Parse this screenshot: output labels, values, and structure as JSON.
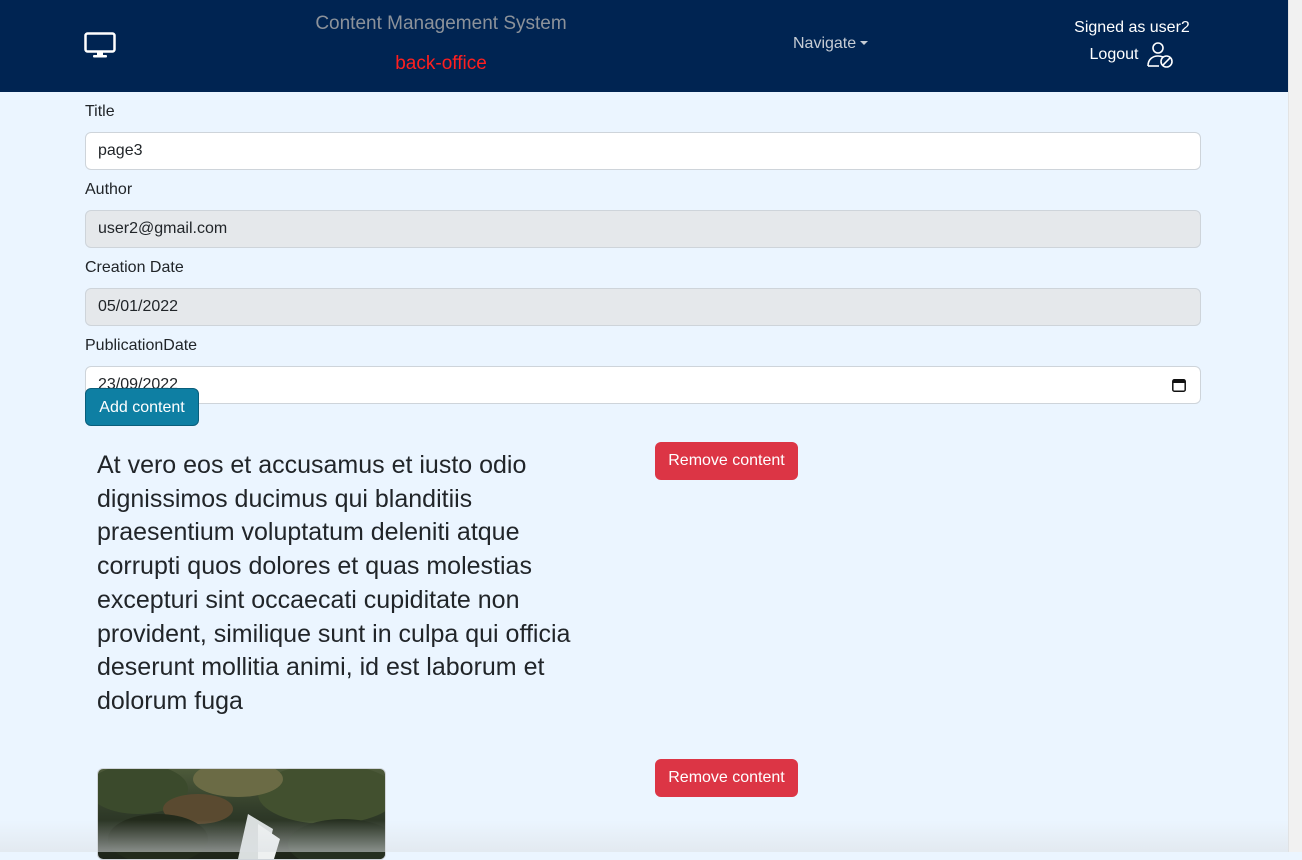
{
  "header": {
    "app_title": "Content Management System",
    "app_subtitle": "back-office",
    "brand_icon": "monitor-icon",
    "nav_label": "Navigate",
    "signed_in_text": "Signed as user2",
    "logout_label": "Logout",
    "logout_icon": "user-slash-icon"
  },
  "form": {
    "title_label": "Title",
    "title_value": "page3",
    "author_label": "Author",
    "author_value": "user2@gmail.com",
    "creation_label": "Creation Date",
    "creation_value": "05/01/2022",
    "publication_label": "PublicationDate",
    "publication_value": "23/09/2022",
    "add_content_label": "Add content"
  },
  "contents": [
    {
      "type": "text",
      "text": "At vero eos et accusamus et iusto odio dignissimos ducimus qui blanditiis praesentium voluptatum deleniti atque corrupti quos dolores et quas molestias excepturi sint occaecati cupiditate non provident, similique sunt in culpa qui officia deserunt mollitia animi, id est laborum et dolorum fuga",
      "remove_label": "Remove content"
    },
    {
      "type": "image",
      "remove_label": "Remove content"
    }
  ],
  "colors": {
    "navbar": "#002452",
    "page_background": "#ebf5ff",
    "subtitle_red": "#ff1f1f",
    "add_button": "#0e7fa3",
    "remove_button": "#dc3545"
  }
}
